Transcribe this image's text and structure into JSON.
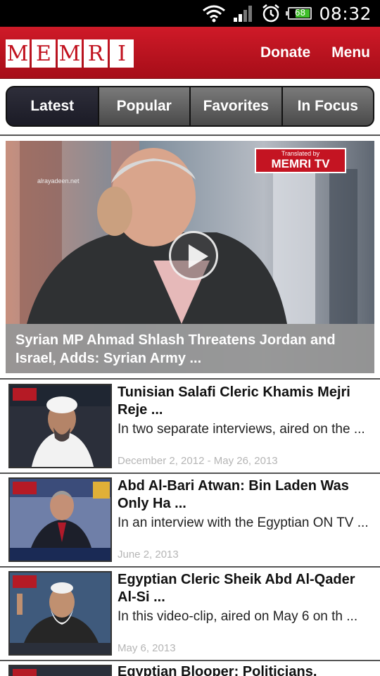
{
  "status_bar": {
    "time": "08:32",
    "battery_level": "68",
    "icons": [
      "wifi-icon",
      "signal-icon",
      "alarm-icon",
      "battery-icon"
    ]
  },
  "header": {
    "logo_letters": [
      "M",
      "E",
      "M",
      "R",
      "I"
    ],
    "donate_label": "Donate",
    "menu_label": "Menu"
  },
  "tabs": [
    {
      "label": "Latest",
      "selected": true
    },
    {
      "label": "Popular",
      "selected": false
    },
    {
      "label": "Favorites",
      "selected": false
    },
    {
      "label": "In Focus",
      "selected": false
    }
  ],
  "featured": {
    "title": "Syrian MP Ahmad Shlash Threatens Jordan and Israel, Adds: Syrian Army  ...",
    "badge_small": "Translated by",
    "badge_big": "MEMRI TV",
    "icon": "play-icon"
  },
  "articles": [
    {
      "title": "Tunisian Salafi Cleric Khamis Mejri Reje ...",
      "description": "In two separate interviews, aired on the ...",
      "date": "December 2, 2012 - May 26, 2013"
    },
    {
      "title": "Abd Al-Bari Atwan: Bin Laden Was Only Ha ...",
      "description": "In an interview with the Egyptian ON TV  ...",
      "date": "June 2, 2013"
    },
    {
      "title": "Egyptian Cleric Sheik Abd Al-Qader Al-Si ...",
      "description": "In this video-clip, aired on May 6 on th ...",
      "date": "May 6, 2013"
    },
    {
      "title": "Egyptian Blooper: Politicians, Unaware T",
      "description": "",
      "date": ""
    }
  ],
  "colors": {
    "brand_red": "#c1121f",
    "tab_selected": "#1b1b26",
    "tab_normal": "#5a5a5a",
    "date_text": "#b5b5b5"
  }
}
